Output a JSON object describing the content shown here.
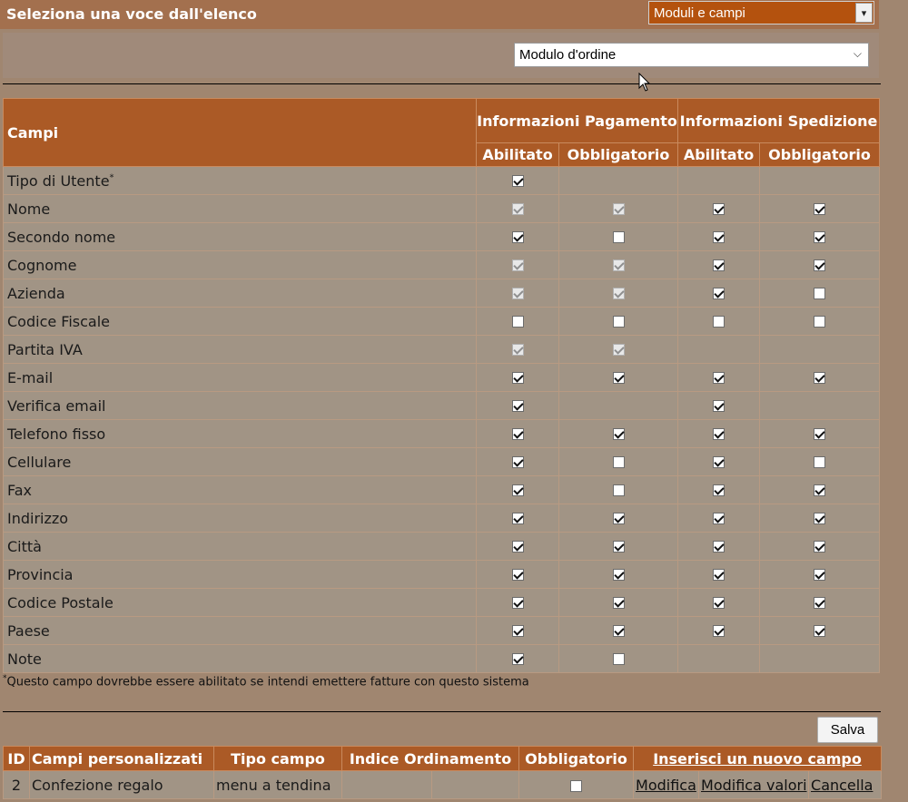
{
  "header": {
    "title": "Seleziona una voce dall'elenco",
    "section_select_value": "Moduli e campi",
    "form_select_value": "Modulo d'ordine"
  },
  "fields_table": {
    "col_campi": "Campi",
    "group_payment": "Informazioni Pagamento",
    "group_shipping": "Informazioni Spedizione",
    "col_enabled": "Abilitato",
    "col_required": "Obbligatorio",
    "rows": [
      {
        "name": "Tipo di Utente",
        "sup": "*",
        "pe": "checked",
        "pr": "none",
        "se": "none",
        "sr": "none"
      },
      {
        "name": "Nome",
        "sup": "",
        "pe": "disabled-checked",
        "pr": "disabled-checked",
        "se": "checked",
        "sr": "checked"
      },
      {
        "name": "Secondo nome",
        "sup": "",
        "pe": "checked",
        "pr": "unchecked",
        "se": "checked",
        "sr": "checked"
      },
      {
        "name": "Cognome",
        "sup": "",
        "pe": "disabled-checked",
        "pr": "disabled-checked",
        "se": "checked",
        "sr": "checked"
      },
      {
        "name": "Azienda",
        "sup": "",
        "pe": "disabled-checked",
        "pr": "disabled-checked",
        "se": "checked",
        "sr": "unchecked"
      },
      {
        "name": "Codice Fiscale",
        "sup": "",
        "pe": "unchecked",
        "pr": "unchecked",
        "se": "unchecked",
        "sr": "unchecked"
      },
      {
        "name": "Partita IVA",
        "sup": "",
        "pe": "disabled-checked",
        "pr": "disabled-checked",
        "se": "none",
        "sr": "none"
      },
      {
        "name": "E-mail",
        "sup": "",
        "pe": "checked",
        "pr": "checked",
        "se": "checked",
        "sr": "checked"
      },
      {
        "name": "Verifica email",
        "sup": "",
        "pe": "checked",
        "pr": "none",
        "se": "checked",
        "sr": "none"
      },
      {
        "name": "Telefono fisso",
        "sup": "",
        "pe": "checked",
        "pr": "checked",
        "se": "checked",
        "sr": "checked"
      },
      {
        "name": "Cellulare",
        "sup": "",
        "pe": "checked",
        "pr": "unchecked",
        "se": "checked",
        "sr": "unchecked"
      },
      {
        "name": "Fax",
        "sup": "",
        "pe": "checked",
        "pr": "unchecked",
        "se": "checked",
        "sr": "checked"
      },
      {
        "name": "Indirizzo",
        "sup": "",
        "pe": "checked",
        "pr": "checked",
        "se": "checked",
        "sr": "checked"
      },
      {
        "name": "Città",
        "sup": "",
        "pe": "checked",
        "pr": "checked",
        "se": "checked",
        "sr": "checked"
      },
      {
        "name": "Provincia",
        "sup": "",
        "pe": "checked",
        "pr": "checked",
        "se": "checked",
        "sr": "checked"
      },
      {
        "name": "Codice Postale",
        "sup": "",
        "pe": "checked",
        "pr": "checked",
        "se": "checked",
        "sr": "checked"
      },
      {
        "name": "Paese",
        "sup": "",
        "pe": "checked",
        "pr": "checked",
        "se": "checked",
        "sr": "checked"
      },
      {
        "name": "Note",
        "sup": "",
        "pe": "checked",
        "pr": "unchecked",
        "se": "none",
        "sr": "none"
      }
    ]
  },
  "footnote": {
    "mark": "*",
    "text": "Questo campo dovrebbe essere abilitato se intendi emettere fatture con questo sistema"
  },
  "save_label": "Salva",
  "custom_fields": {
    "col_id": "ID",
    "col_name": "Campi personalizzati",
    "col_type": "Tipo campo",
    "col_order": "Indice Ordinamento",
    "col_required": "Obbligatorio",
    "add_link": "Inserisci un nuovo campo",
    "rows": [
      {
        "id": "2",
        "name": "Confezione regalo",
        "type": "menu a tendina",
        "order": "",
        "required": false,
        "edit": "Modifica",
        "edit_values": "Modifica valori",
        "delete": "Cancella"
      }
    ]
  },
  "colors": {
    "page_bg": "#a08670",
    "header_bg": "#ab5a26",
    "row_bg": "#a19485",
    "accent_select": "#b4520e"
  },
  "icons": {
    "dropdown": "chevron-down-icon",
    "cursor": "mouse-pointer-icon"
  }
}
